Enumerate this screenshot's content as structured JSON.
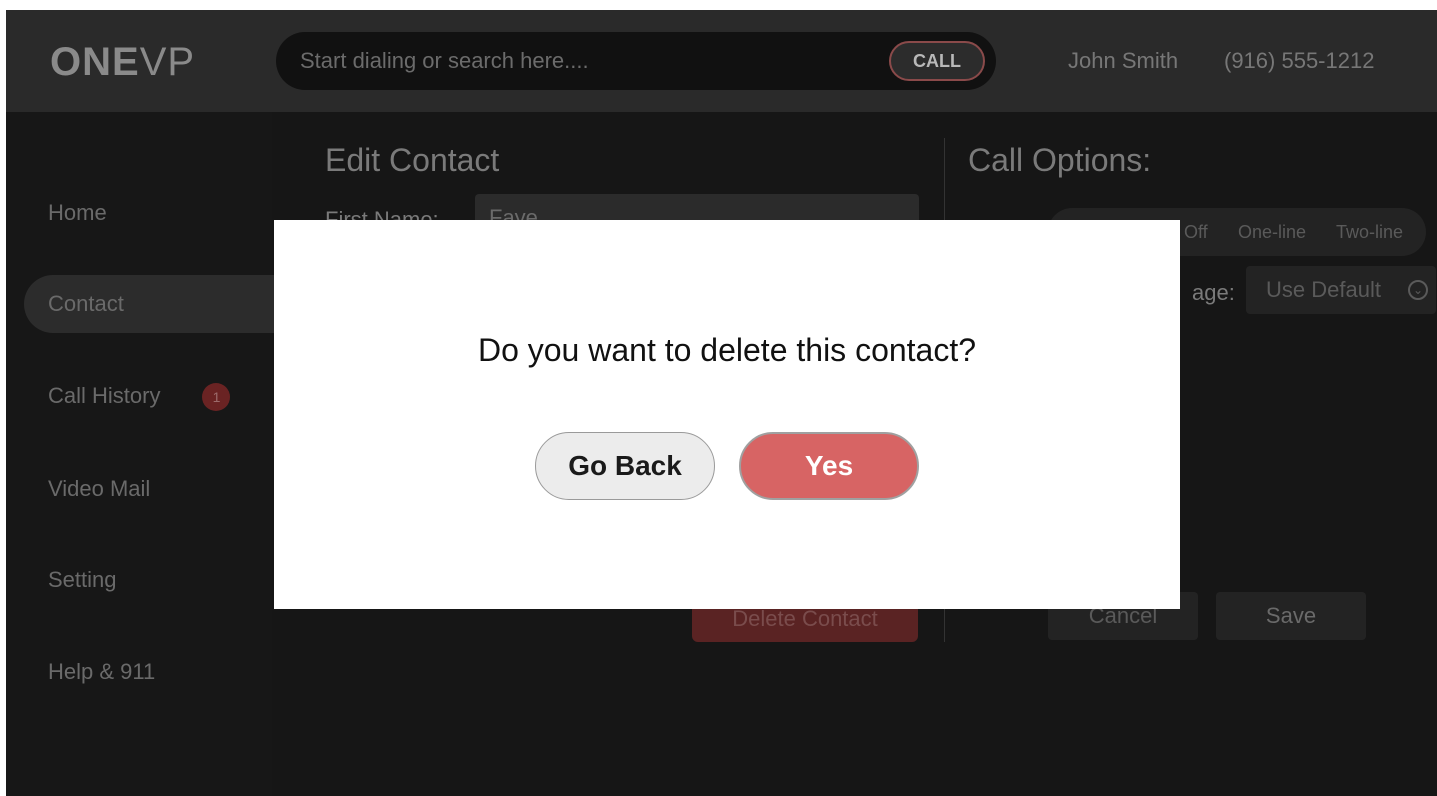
{
  "header": {
    "logo_bold": "ONE",
    "logo_light": "VP",
    "search_placeholder": "Start dialing or search here....",
    "call_label": "CALL",
    "user_name": "John Smith",
    "user_phone": "(916) 555-1212"
  },
  "sidebar": {
    "items": [
      {
        "label": "Home"
      },
      {
        "label": "Contact"
      },
      {
        "label": "Call History",
        "badge": "1"
      },
      {
        "label": "Video Mail"
      },
      {
        "label": "Setting"
      },
      {
        "label": "Help & 911"
      }
    ]
  },
  "edit_contact": {
    "title": "Edit Contact",
    "first_name_label": "First Name:",
    "first_name_value": "Faye",
    "delete_label": "Delete Contact"
  },
  "call_options": {
    "title": "Call Options:",
    "caption_options": [
      "Off",
      "One-line",
      "Two-line"
    ],
    "language_label": "age:",
    "language_value": "Use Default",
    "cancel_label": "Cancel",
    "save_label": "Save"
  },
  "modal": {
    "question": "Do you want to delete this contact?",
    "go_back_label": "Go Back",
    "yes_label": "Yes"
  },
  "colors": {
    "accent_red": "#d76464",
    "background": "#161616",
    "header": "#2a2a2a"
  }
}
